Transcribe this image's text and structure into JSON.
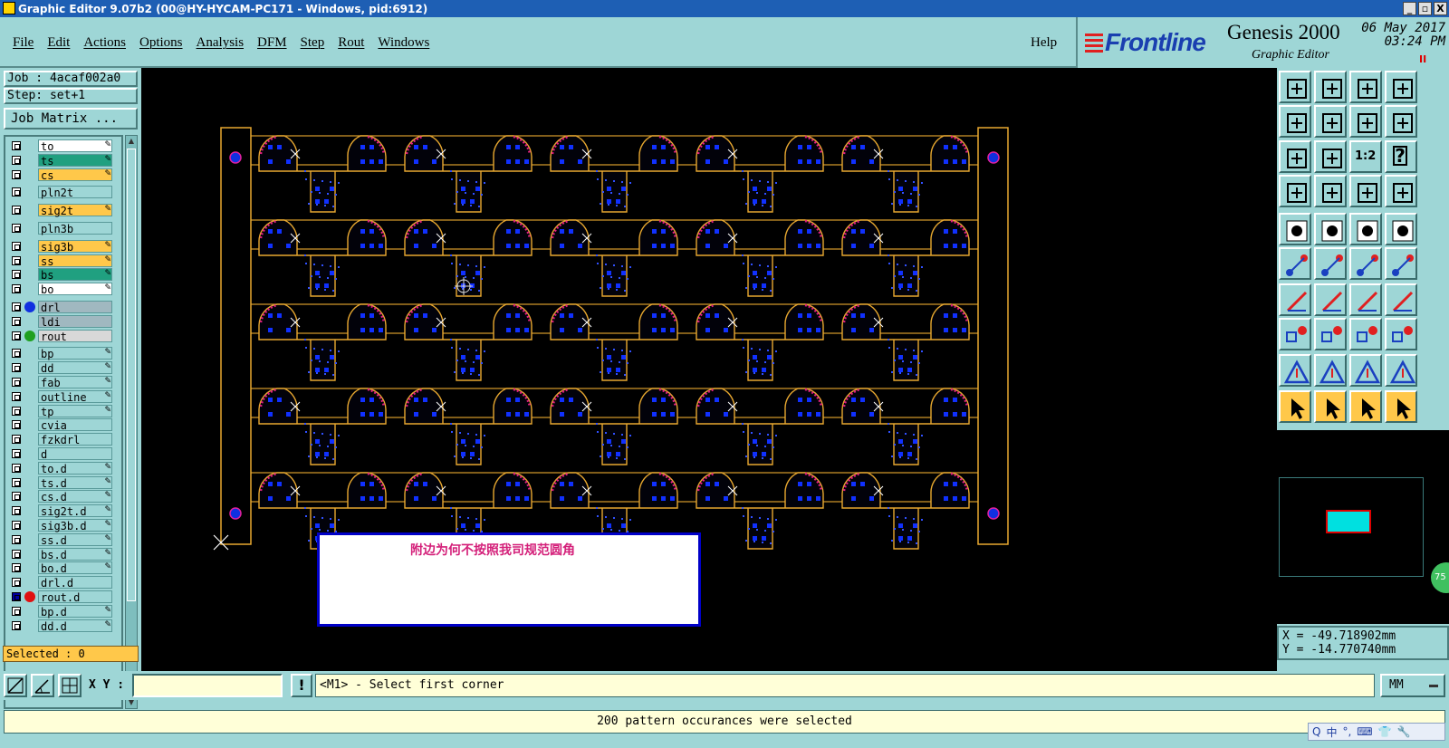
{
  "window": {
    "title": "Graphic Editor 9.07b2 (00@HY-HYCAM-PC171 - Windows, pid:6912)",
    "min": "_",
    "max": "▫",
    "close": "X"
  },
  "menu": {
    "items": [
      "File",
      "Edit",
      "Actions",
      "Options",
      "Analysis",
      "DFM",
      "Step",
      "Rout",
      "Windows"
    ],
    "help": "Help"
  },
  "brand": {
    "logo": "Frontline",
    "product": "Genesis 2000",
    "subtitle": "Graphic Editor",
    "date": "06 May 2017",
    "time": "03:24 PM",
    "pause": "II"
  },
  "job": {
    "job_label": "Job : 4acaf002a0",
    "step_label": "Step: set+1",
    "matrix_button": "Job Matrix ..."
  },
  "layers": [
    {
      "name": "to",
      "color": "#ffffff",
      "edit": true
    },
    {
      "name": "ts",
      "color": "#20a080",
      "edit": true
    },
    {
      "name": "cs",
      "color": "#ffc84a",
      "edit": true
    },
    {
      "name": "pln2t",
      "color": "#9ed6d6",
      "edit": false
    },
    {
      "name": "sig2t",
      "color": "#ffc84a",
      "edit": true
    },
    {
      "name": "pln3b",
      "color": "#9ed6d6",
      "edit": false
    },
    {
      "name": "sig3b",
      "color": "#ffc84a",
      "edit": true
    },
    {
      "name": "ss",
      "color": "#ffc84a",
      "edit": true
    },
    {
      "name": "bs",
      "color": "#20a080",
      "edit": true
    },
    {
      "name": "bo",
      "color": "#ffffff",
      "edit": true
    },
    {
      "name": "drl",
      "color": "#a0b8c0",
      "edit": false,
      "dot": "#1030e0"
    },
    {
      "name": "ldi",
      "color": "#a0b8c0",
      "edit": false
    },
    {
      "name": "rout",
      "color": "#d8d8d8",
      "edit": false,
      "dot": "#20a020"
    },
    {
      "name": "bp",
      "color": "#9ed6d6",
      "edit": true
    },
    {
      "name": "dd",
      "color": "#9ed6d6",
      "edit": true
    },
    {
      "name": "fab",
      "color": "#9ed6d6",
      "edit": true
    },
    {
      "name": "outline",
      "color": "#9ed6d6",
      "edit": true
    },
    {
      "name": "tp",
      "color": "#9ed6d6",
      "edit": true
    },
    {
      "name": "cvia",
      "color": "#9ed6d6",
      "edit": false
    },
    {
      "name": "fzkdrl",
      "color": "#9ed6d6",
      "edit": false
    },
    {
      "name": "d",
      "color": "#9ed6d6",
      "edit": false
    },
    {
      "name": "to.d",
      "color": "#9ed6d6",
      "edit": true
    },
    {
      "name": "ts.d",
      "color": "#9ed6d6",
      "edit": true
    },
    {
      "name": "cs.d",
      "color": "#9ed6d6",
      "edit": true
    },
    {
      "name": "sig2t.d",
      "color": "#9ed6d6",
      "edit": true
    },
    {
      "name": "sig3b.d",
      "color": "#9ed6d6",
      "edit": true
    },
    {
      "name": "ss.d",
      "color": "#9ed6d6",
      "edit": true
    },
    {
      "name": "bs.d",
      "color": "#9ed6d6",
      "edit": true
    },
    {
      "name": "bo.d",
      "color": "#9ed6d6",
      "edit": true
    },
    {
      "name": "drl.d",
      "color": "#9ed6d6",
      "edit": false
    },
    {
      "name": "rout.d",
      "color": "#9ed6d6",
      "edit": false,
      "dot": "#e01010",
      "selected": true
    },
    {
      "name": "bp.d",
      "color": "#9ed6d6",
      "edit": true
    },
    {
      "name": "dd.d",
      "color": "#9ed6d6",
      "edit": true
    }
  ],
  "selected_label": "Selected : 0",
  "canvas": {
    "note": "附边为何不按照我司规范圆角"
  },
  "toolbox": {
    "ratio_label": "1:2",
    "help_label": "?"
  },
  "minimap": {
    "zoom": "75"
  },
  "coords": {
    "x": "X = -49.718902mm",
    "y": "Y = -14.770740mm"
  },
  "bottom": {
    "xy_label": "X Y :",
    "xy_value": "",
    "excl": "!",
    "prompt": "<M1> - Select first corner",
    "unit": "MM"
  },
  "status": "200 pattern occurances were selected",
  "ime": {
    "items": [
      "Q",
      "中",
      "°,",
      "⌨",
      "👕",
      "🔧"
    ]
  }
}
